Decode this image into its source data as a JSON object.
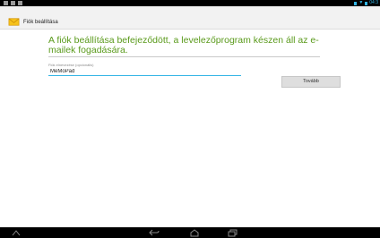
{
  "status_bar": {
    "time": "04:3"
  },
  "action_bar": {
    "title": "Fiók beállítása",
    "icon": "envelope-app-icon"
  },
  "main": {
    "headline": "A fiók beállítása befejeződött, a levelezőprogram készen áll az e-mailek fogadására.",
    "account_name_label": "Fiók elnevezése (opcionális)",
    "account_name_value": "MeMoPad",
    "next_button_label": "Tovább"
  },
  "nav_bar": {
    "icons": [
      "up-arrow-icon",
      "back-icon",
      "home-icon",
      "recent-apps-icon"
    ]
  },
  "colors": {
    "accent": "#33b5e5",
    "headline": "#5a9a1b"
  }
}
